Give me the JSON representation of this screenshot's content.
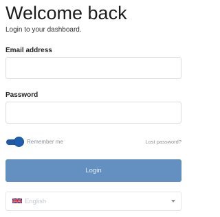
{
  "header": {
    "title": "Welcome back",
    "subtitle": "Login to your dashboard."
  },
  "form": {
    "email_label": "Email address",
    "email_value": "",
    "password_label": "Password",
    "password_value": "",
    "remember_label": "Remember me",
    "remember_checked": true,
    "lost_password_label": "Lost password?",
    "login_button_label": "Login"
  },
  "language": {
    "selected": "English",
    "flag_icon": "uk-flag-icon"
  },
  "colors": {
    "accent": "#1f5fb0",
    "button": "#6390c1"
  }
}
